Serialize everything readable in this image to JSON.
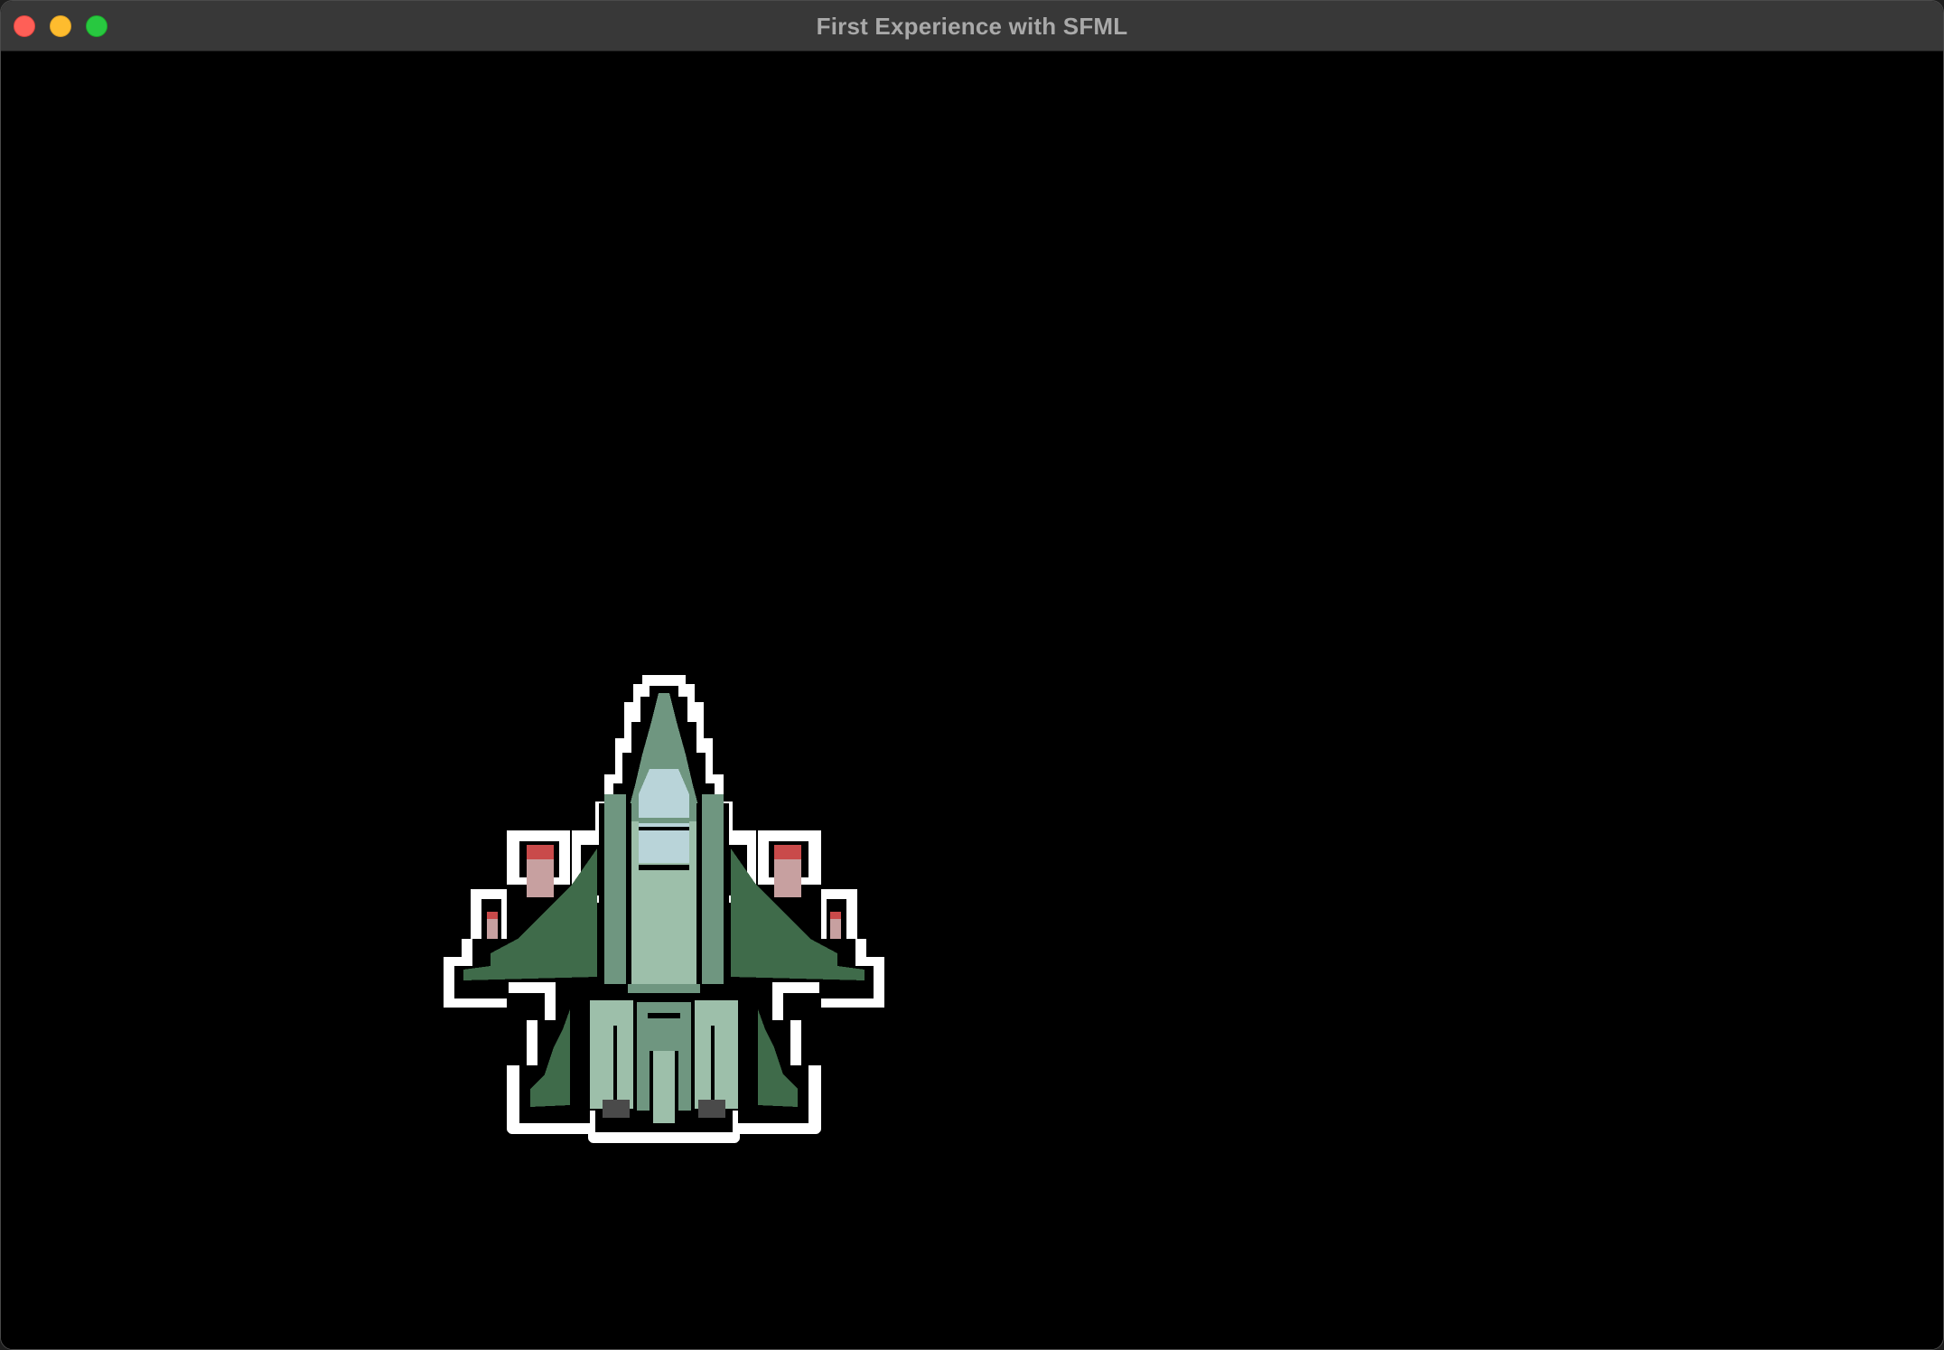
{
  "window": {
    "title": "First Experience with SFML",
    "controls": [
      "close",
      "minimize",
      "zoom"
    ]
  },
  "scene": {
    "background_color": "#000000",
    "sprites": [
      {
        "name": "player-fighter-jet",
        "icon": "fighter-jet-sprite",
        "colors": {
          "outline": "#ffffff",
          "border": "#000000",
          "hull_dark": "#3f6b4a",
          "hull_mid": "#6f9680",
          "hull_light": "#9dbfaa",
          "canopy": "#b9d4d9",
          "engine_red": "#c94a4a",
          "engine_pink": "#c7a0a0",
          "exhaust": "#4a4a4a"
        }
      }
    ]
  }
}
